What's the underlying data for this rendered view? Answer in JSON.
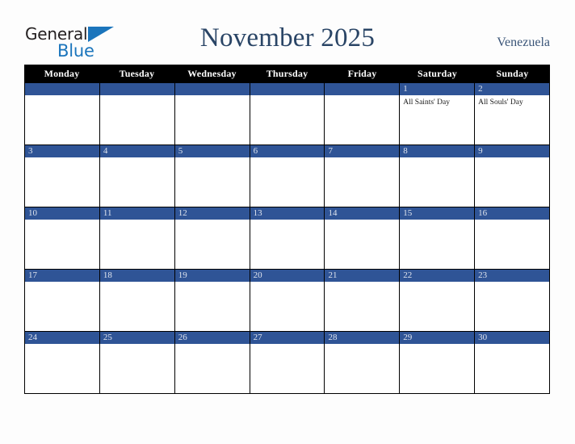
{
  "brand": {
    "name_part1": "General",
    "name_part2": "Blue",
    "triangle_color": "#1b75bc",
    "text_color": "#231f20"
  },
  "header": {
    "title": "November 2025",
    "country": "Venezuela",
    "title_color": "#2a4566",
    "country_color": "#3a5578"
  },
  "theme": {
    "day_header_bg": "#000000",
    "day_header_text": "#ffffff",
    "date_bar_bg": "#2f5496",
    "date_text": "#dfe4ee",
    "cell_bg": "#ffffff",
    "grid_line": "#000000",
    "page_bg": "#fdfdfd"
  },
  "weekday_headers": [
    "Monday",
    "Tuesday",
    "Wednesday",
    "Thursday",
    "Friday",
    "Saturday",
    "Sunday"
  ],
  "weeks": [
    [
      {
        "date": "",
        "events": []
      },
      {
        "date": "",
        "events": []
      },
      {
        "date": "",
        "events": []
      },
      {
        "date": "",
        "events": []
      },
      {
        "date": "",
        "events": []
      },
      {
        "date": "1",
        "events": [
          "All Saints' Day"
        ]
      },
      {
        "date": "2",
        "events": [
          "All Souls' Day"
        ]
      }
    ],
    [
      {
        "date": "3",
        "events": []
      },
      {
        "date": "4",
        "events": []
      },
      {
        "date": "5",
        "events": []
      },
      {
        "date": "6",
        "events": []
      },
      {
        "date": "7",
        "events": []
      },
      {
        "date": "8",
        "events": []
      },
      {
        "date": "9",
        "events": []
      }
    ],
    [
      {
        "date": "10",
        "events": []
      },
      {
        "date": "11",
        "events": []
      },
      {
        "date": "12",
        "events": []
      },
      {
        "date": "13",
        "events": []
      },
      {
        "date": "14",
        "events": []
      },
      {
        "date": "15",
        "events": []
      },
      {
        "date": "16",
        "events": []
      }
    ],
    [
      {
        "date": "17",
        "events": []
      },
      {
        "date": "18",
        "events": []
      },
      {
        "date": "19",
        "events": []
      },
      {
        "date": "20",
        "events": []
      },
      {
        "date": "21",
        "events": []
      },
      {
        "date": "22",
        "events": []
      },
      {
        "date": "23",
        "events": []
      }
    ],
    [
      {
        "date": "24",
        "events": []
      },
      {
        "date": "25",
        "events": []
      },
      {
        "date": "26",
        "events": []
      },
      {
        "date": "27",
        "events": []
      },
      {
        "date": "28",
        "events": []
      },
      {
        "date": "29",
        "events": []
      },
      {
        "date": "30",
        "events": []
      }
    ]
  ]
}
